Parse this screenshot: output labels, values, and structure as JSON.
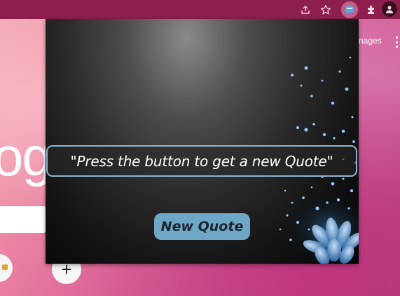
{
  "browser": {
    "toolbar_icons": [
      "share-icon",
      "star-icon",
      "quote-extension-icon",
      "puzzle-icon",
      "profile-icon"
    ],
    "accent": "#8c1f4d"
  },
  "newtab": {
    "logo_fragment": "og",
    "images_link": "nages",
    "add_shortcut_symbol": "+"
  },
  "popup": {
    "quote": "\"Press the button to get a new Quote\"",
    "button_label": "New Quote",
    "button_color": "#6fa8c6",
    "quote_border_color": "#8fb4cf"
  }
}
